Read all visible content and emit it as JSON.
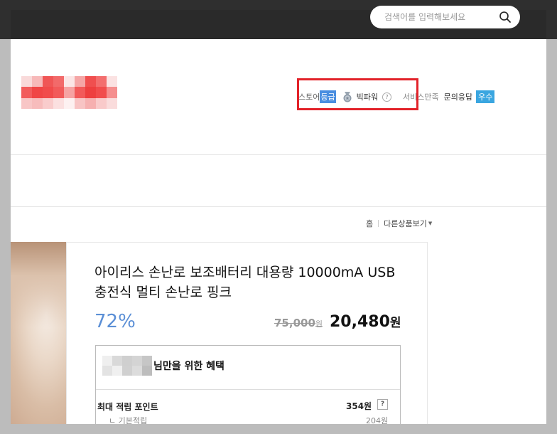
{
  "search": {
    "placeholder": "검색어를 입력해보세요"
  },
  "store_info": {
    "store_label": "스토어",
    "grade_label": "등급",
    "grade_name": "빅파워",
    "help_mark": "?",
    "service_label": "서비스만족",
    "response_label": "문의응답",
    "response_badge": "우수"
  },
  "nav": {
    "home": "홈",
    "other_products": "다른상품보기"
  },
  "product": {
    "title": "아이리스 손난로 보조배터리 대용량 10000mA USB 충전식 멀티 손난로 핑크",
    "discount": "72%",
    "original_price": "75,000",
    "original_unit": "원",
    "sale_price": "20,480",
    "sale_unit": "원"
  },
  "benefits": {
    "header": "님만을 위한 혜택",
    "max_points_label": "최대 적립 포인트",
    "max_points_value": "354원",
    "help_mark": "?",
    "base_label": "ㄴ 기본적립",
    "base_value": "204원"
  },
  "colors": {
    "grade_badge": "#4a8ee0",
    "good_badge": "#3aa6e0",
    "discount": "#5b8fd6",
    "highlight": "#e22229"
  }
}
